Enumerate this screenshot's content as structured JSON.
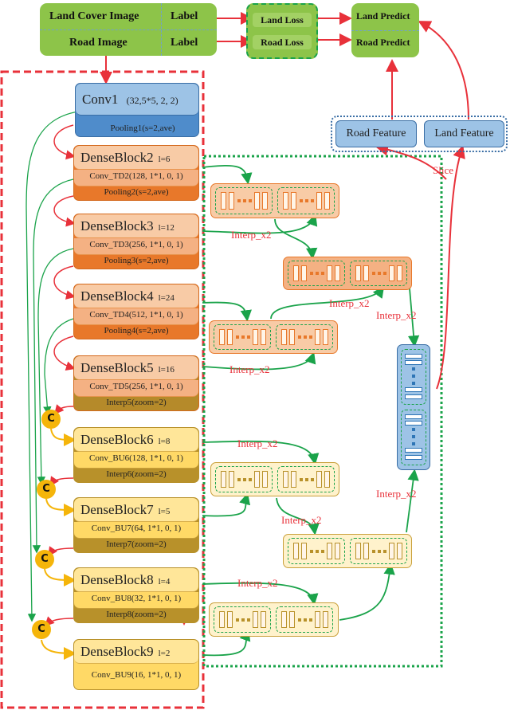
{
  "inputs": {
    "land_cover_image": "Land Cover Image",
    "road_image": "Road Image",
    "label_1": "Label",
    "label_2": "Label"
  },
  "losses": {
    "land_loss": "Land Loss",
    "road_loss": "Road Loss"
  },
  "predicts": {
    "land_predict": "Land Predict",
    "road_predict": "Road Predict"
  },
  "features": {
    "road_feature": "Road Feature",
    "land_feature": "Land Feature",
    "slice_label": "Slice"
  },
  "conv1": {
    "name": "Conv1",
    "params": "(32,5*5, 2, 2)",
    "pooling": "Pooling1(s=2,ave)"
  },
  "encoder_blocks": [
    {
      "name": "DenseBlock2",
      "l": "l=6",
      "conv": "Conv_TD2(128, 1*1, 0, 1)",
      "op": "Pooling2(s=2,ave)"
    },
    {
      "name": "DenseBlock3",
      "l": "l=12",
      "conv": "Conv_TD3(256, 1*1, 0, 1)",
      "op": "Pooling3(s=2,ave)"
    },
    {
      "name": "DenseBlock4",
      "l": "l=24",
      "conv": "Conv_TD4(512, 1*1, 0, 1)",
      "op": "Pooling4(s=2,ave)"
    },
    {
      "name": "DenseBlock5",
      "l": "l=16",
      "conv": "Conv_TD5(256, 1*1, 0, 1)",
      "op": "Interp5(zoom=2)"
    }
  ],
  "decoder_blocks": [
    {
      "name": "DenseBlock6",
      "l": "l=8",
      "conv": "Conv_BU6(128, 1*1, 0, 1)",
      "op": "Interp6(zoom=2)"
    },
    {
      "name": "DenseBlock7",
      "l": "l=5",
      "conv": "Conv_BU7(64, 1*1, 0, 1)",
      "op": "Interp7(zoom=2)"
    },
    {
      "name": "DenseBlock8",
      "l": "l=4",
      "conv": "Conv_BU8(32, 1*1, 0, 1)",
      "op": "Interp8(zoom=2)"
    },
    {
      "name": "DenseBlock9",
      "l": "l=2",
      "conv": "Conv_BU9(16, 1*1, 0, 1)",
      "op": ""
    }
  ],
  "concat_label": "C",
  "interp_label": "Interp_x2",
  "colors": {
    "green": "#8dc449",
    "red_arrow": "#e8313a",
    "green_arrow": "#1aa34a",
    "orange": "#e8782a",
    "yellow": "#ffd966",
    "blue": "#9dc3e6",
    "concat": "#f5b50a"
  }
}
